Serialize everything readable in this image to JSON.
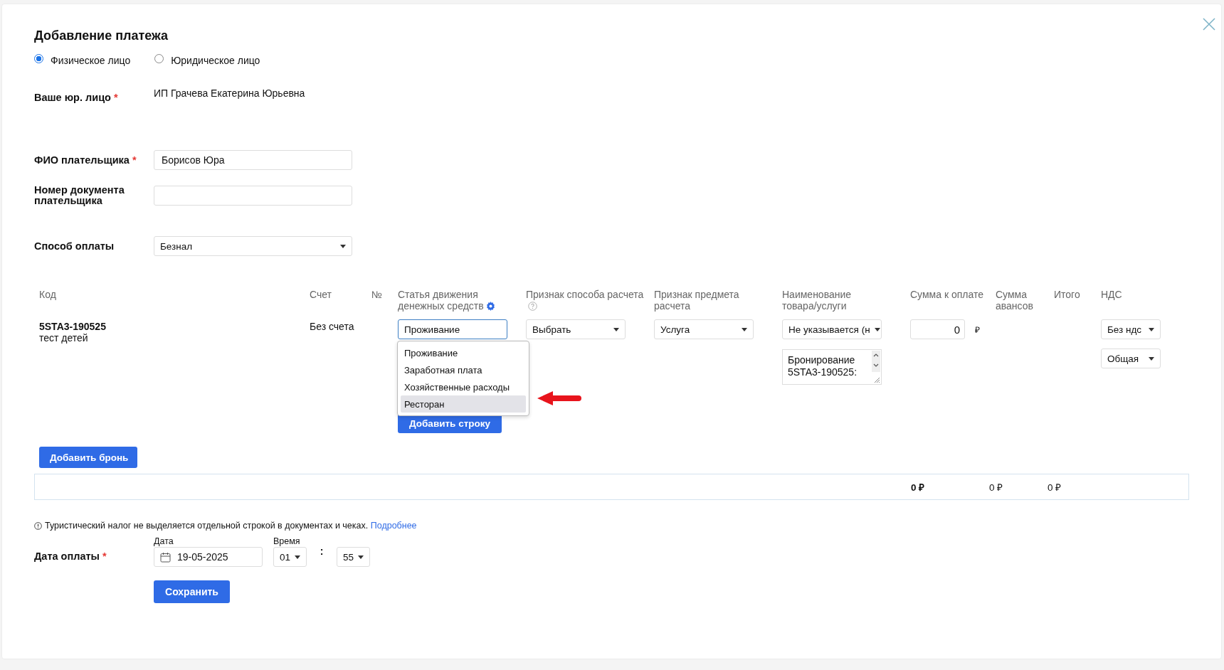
{
  "dialog": {
    "title": "Добавление платежа"
  },
  "payer_type": [
    {
      "label": "Физическое лицо",
      "selected": true
    },
    {
      "label": "Юридическое лицо",
      "selected": false
    }
  ],
  "fields": [
    {
      "kind": "static",
      "label": "Ваше юр. лицо",
      "required_mark": "*",
      "value": "ИП Грачева Екатерина Юрьевна"
    },
    {
      "kind": "input",
      "label": "ФИО плательщика",
      "required_mark": "*",
      "value": "Борисов Юра"
    },
    {
      "kind": "input",
      "label": "Номер документа плательщика"
    },
    {
      "kind": "select",
      "label": "Способ оплаты",
      "value": "Безнал"
    }
  ],
  "table": {
    "columns": [
      "Код",
      "Счет",
      "№",
      "Статья движения денежных средств",
      "Признак способа расчета",
      "Признак предмета расчета",
      "Наименование товара/услуги",
      "Сумма к оплате",
      "Сумма авансов",
      "Итого",
      "НДС"
    ],
    "rows": [
      {
        "code": "5STA3-190525",
        "subtitle": "тест детей",
        "account": "Без счета",
        "cash_flow_item": {
          "value": "Проживание",
          "open": true,
          "options": [
            {
              "label": "Проживание",
              "highlighted": false
            },
            {
              "label": "Заработная плата",
              "highlighted": false
            },
            {
              "label": "Хозяйственные расходы",
              "highlighted": false
            },
            {
              "label": "Ресторан",
              "highlighted": true
            }
          ]
        },
        "payment_method": "Выбрать",
        "subject": "Услуга",
        "item_name": "Не указывается (н",
        "description": "Бронирование 5STA3-190525:",
        "amount": "0",
        "currency": "₽",
        "vat": "Без ндс",
        "tax_system": "Общая"
      }
    ],
    "add_row_button": "Добавить строку"
  },
  "add_booking_button": "Добавить бронь",
  "totals": [
    {
      "value": "0 ₽",
      "bold": true
    },
    {
      "value": "0 ₽",
      "bold": false
    },
    {
      "value": "0 ₽",
      "bold": false
    }
  ],
  "notice": {
    "text": "Туристический налог не выделяется отдельной строкой в документах и чеках.",
    "link": "Подробнее"
  },
  "payment_date": {
    "label": "Дата оплаты",
    "required_mark": "*",
    "date_label": "Дата",
    "date": "19-05-2025",
    "time_label": "Время",
    "hour": "01",
    "separator": ":",
    "minute": "55"
  },
  "save_button": "Сохранить"
}
